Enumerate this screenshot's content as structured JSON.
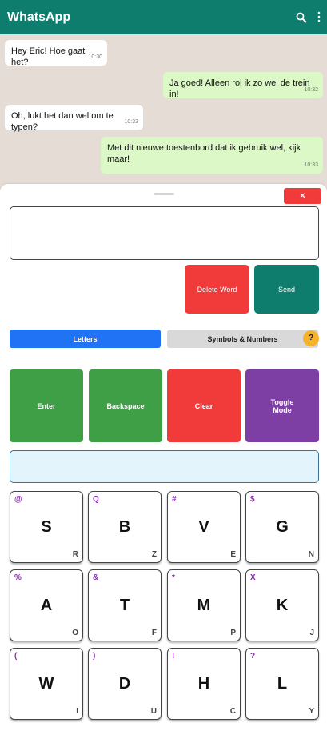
{
  "app": {
    "title": "WhatsApp"
  },
  "icons": {
    "search": "search-icon",
    "menu": "more-vert-icon",
    "close": "close-icon",
    "help": "help-icon"
  },
  "colors": {
    "brand": "#0f7d6d",
    "incoming": "#ffffff",
    "outgoing": "#dcf8c6",
    "danger": "#f13b3b",
    "primary": "#1f73f4",
    "success": "#3f9f46",
    "purple": "#7e3fa4",
    "warning": "#f5b32b",
    "symbol": "#8e2bb5"
  },
  "messages": [
    {
      "text": "Hey Eric! Hoe gaat het?",
      "time": "10:30",
      "direction": "in"
    },
    {
      "text": "Ja goed! Alleen rol ik zo wel de trein in!",
      "time": "10:32",
      "direction": "out"
    },
    {
      "text": "Oh, lukt het dan wel om te typen?",
      "time": "10:33",
      "direction": "in"
    },
    {
      "text": "Met dit nieuwe toestenbord dat ik gebruik wel, kijk maar!",
      "time": "10:33",
      "direction": "out"
    }
  ],
  "keyboard": {
    "close_label": "×",
    "compose_value": "",
    "delete_word_label": "Delete Word",
    "send_label": "Send",
    "tabs": {
      "letters": "Letters",
      "symbols": "Symbols & Numbers",
      "active": "Letters"
    },
    "help_label": "?",
    "controls": {
      "enter": "Enter",
      "backspace": "Backspace",
      "clear": "Clear",
      "toggle": "Toggle Mode"
    },
    "preview_value": "",
    "keys": [
      {
        "main": "S",
        "symbol": "@",
        "alt": "R"
      },
      {
        "main": "B",
        "symbol": "Q",
        "alt": "Z"
      },
      {
        "main": "V",
        "symbol": "#",
        "alt": "E"
      },
      {
        "main": "G",
        "symbol": "$",
        "alt": "N"
      },
      {
        "main": "A",
        "symbol": "%",
        "alt": "O"
      },
      {
        "main": "T",
        "symbol": "&",
        "alt": "F"
      },
      {
        "main": "M",
        "symbol": "*",
        "alt": "P"
      },
      {
        "main": "K",
        "symbol": "X",
        "alt": "J"
      },
      {
        "main": "W",
        "symbol": "(",
        "alt": "I"
      },
      {
        "main": "D",
        "symbol": ")",
        "alt": "U"
      },
      {
        "main": "H",
        "symbol": "!",
        "alt": "C"
      },
      {
        "main": "L",
        "symbol": "?",
        "alt": "Y"
      }
    ]
  }
}
